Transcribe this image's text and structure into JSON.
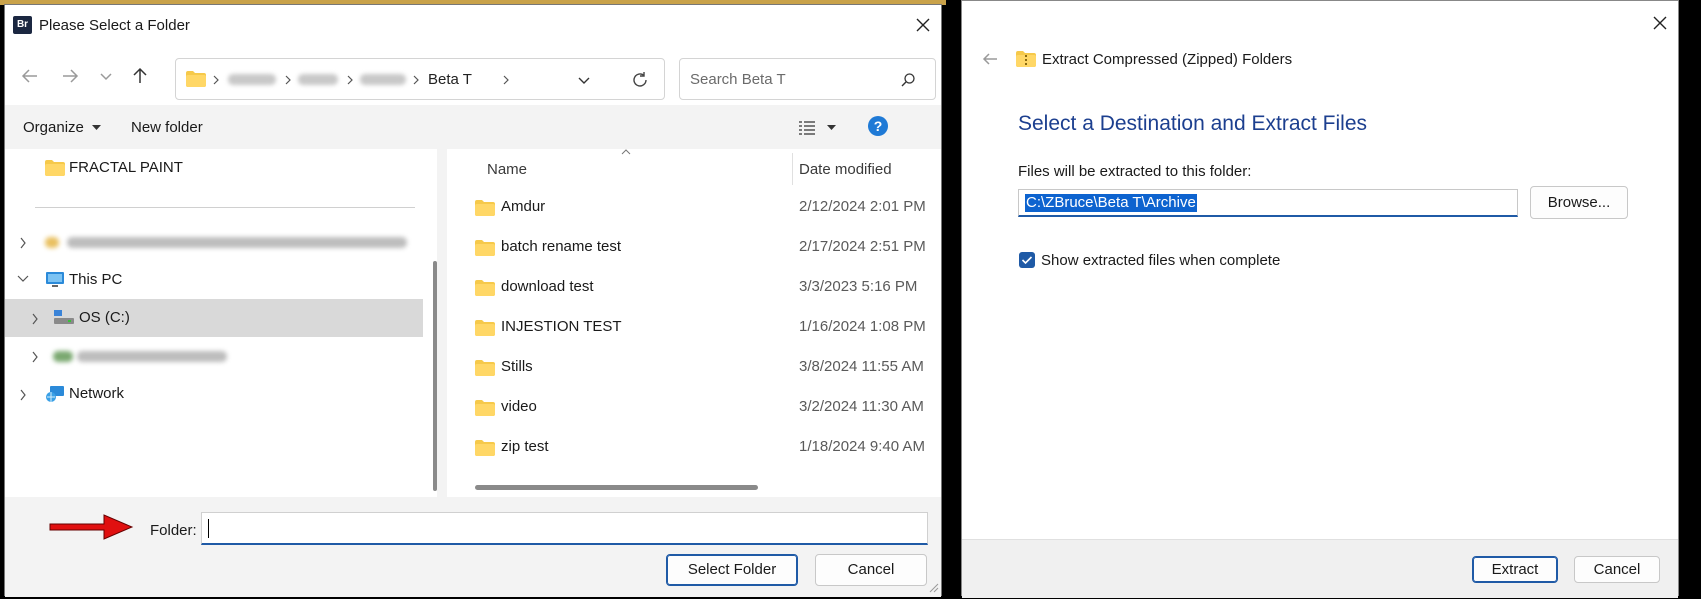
{
  "left_dialog": {
    "app_badge": "Br",
    "title": "Please Select a Folder",
    "address": {
      "last_crumb": "Beta T"
    },
    "search": {
      "placeholder": "Search Beta T"
    },
    "toolbar": {
      "organize_label": "Organize",
      "new_folder_label": "New folder"
    },
    "nav_tree": [
      {
        "label": "FRACTAL PAINT",
        "icon": "folder-icon"
      },
      {
        "label": "This PC",
        "icon": "pc-icon",
        "expanded": true
      },
      {
        "label": "OS (C:)",
        "icon": "drive-icon",
        "selected": true
      },
      {
        "label": "Network",
        "icon": "network-icon"
      }
    ],
    "columns": {
      "name": "Name",
      "date_modified": "Date modified"
    },
    "files": [
      {
        "name": "Amdur",
        "date": "2/12/2024 2:01 PM"
      },
      {
        "name": "batch rename test",
        "date": "2/17/2024 2:51 PM"
      },
      {
        "name": "download test",
        "date": "3/3/2023 5:16 PM"
      },
      {
        "name": "INJESTION TEST",
        "date": "1/16/2024 1:08 PM"
      },
      {
        "name": "Stills",
        "date": "3/8/2024 11:55 AM"
      },
      {
        "name": "video",
        "date": "3/2/2024 11:30 AM"
      },
      {
        "name": "zip test",
        "date": "1/18/2024 9:40 AM"
      }
    ],
    "folder_field": {
      "label": "Folder:",
      "value": ""
    },
    "buttons": {
      "select_folder": "Select Folder",
      "cancel": "Cancel"
    }
  },
  "right_dialog": {
    "wizard_title": "Extract Compressed (Zipped) Folders",
    "heading": "Select a Destination and Extract Files",
    "destination_label": "Files will be extracted to this folder:",
    "destination_path": "C:\\ZBruce\\Beta T\\Archive",
    "browse_label": "Browse...",
    "show_files_label": "Show extracted files when complete",
    "show_files_checked": true,
    "buttons": {
      "extract": "Extract",
      "cancel": "Cancel"
    }
  },
  "colors": {
    "accent_blue": "#1f5aa6",
    "heading_blue": "#1c3f8f",
    "selection_blue": "#0d63cf",
    "folder_yellow": "#f6c94a",
    "arrow_red": "#e01010"
  }
}
